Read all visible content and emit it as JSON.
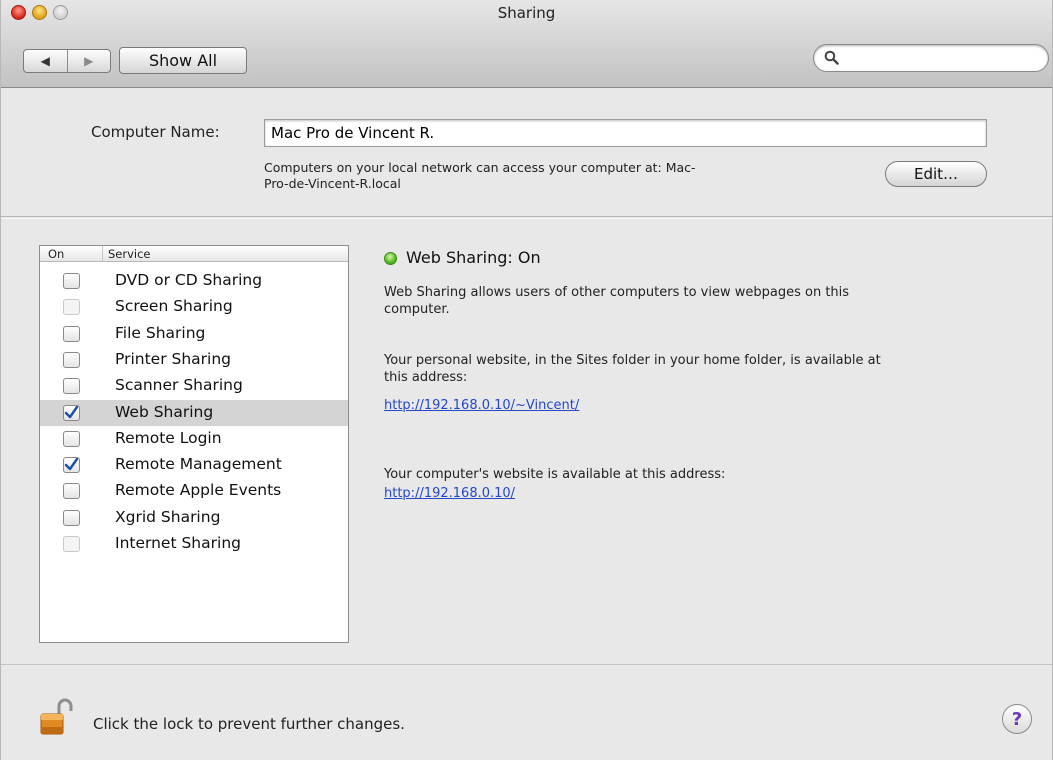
{
  "window": {
    "title": "Sharing"
  },
  "toolbar": {
    "back_glyph": "◀",
    "forward_glyph": "▶",
    "show_all_label": "Show All",
    "search_icon": "search-icon",
    "search_placeholder": ""
  },
  "computer_name": {
    "label": "Computer Name:",
    "value": "Mac Pro de Vincent R.",
    "description_line1": "Computers on your local network can access your computer at: Mac-",
    "description_line2": "Pro-de-Vincent-R.local",
    "edit_label": "Edit…"
  },
  "services": {
    "header_on": "On",
    "header_service": "Service",
    "items": [
      {
        "label": "DVD or CD Sharing",
        "checked": false,
        "enabled": true,
        "selected": false
      },
      {
        "label": "Screen Sharing",
        "checked": false,
        "enabled": false,
        "selected": false
      },
      {
        "label": "File Sharing",
        "checked": false,
        "enabled": true,
        "selected": false
      },
      {
        "label": "Printer Sharing",
        "checked": false,
        "enabled": true,
        "selected": false
      },
      {
        "label": "Scanner Sharing",
        "checked": false,
        "enabled": true,
        "selected": false
      },
      {
        "label": "Web Sharing",
        "checked": true,
        "enabled": true,
        "selected": true
      },
      {
        "label": "Remote Login",
        "checked": false,
        "enabled": true,
        "selected": false
      },
      {
        "label": "Remote Management",
        "checked": true,
        "enabled": true,
        "selected": false
      },
      {
        "label": "Remote Apple Events",
        "checked": false,
        "enabled": true,
        "selected": false
      },
      {
        "label": "Xgrid Sharing",
        "checked": false,
        "enabled": true,
        "selected": false
      },
      {
        "label": "Internet Sharing",
        "checked": false,
        "enabled": false,
        "selected": false
      }
    ]
  },
  "detail": {
    "status_color": "#4db01c",
    "status_title": "Web Sharing: On",
    "description_line1": "Web Sharing allows users of other computers to view webpages on this",
    "description_line2": "computer.",
    "personal_line1": "Your personal website, in the Sites folder in your home folder, is available at",
    "personal_line2": "this address:",
    "personal_link": "http://192.168.0.10/~Vincent/",
    "computer_text": "Your computer's website is available at this address:",
    "computer_link": "http://192.168.0.10/"
  },
  "footer": {
    "lock_icon": "unlocked-padlock-icon",
    "lock_text": "Click the lock to prevent further changes.",
    "help_label": "?"
  }
}
